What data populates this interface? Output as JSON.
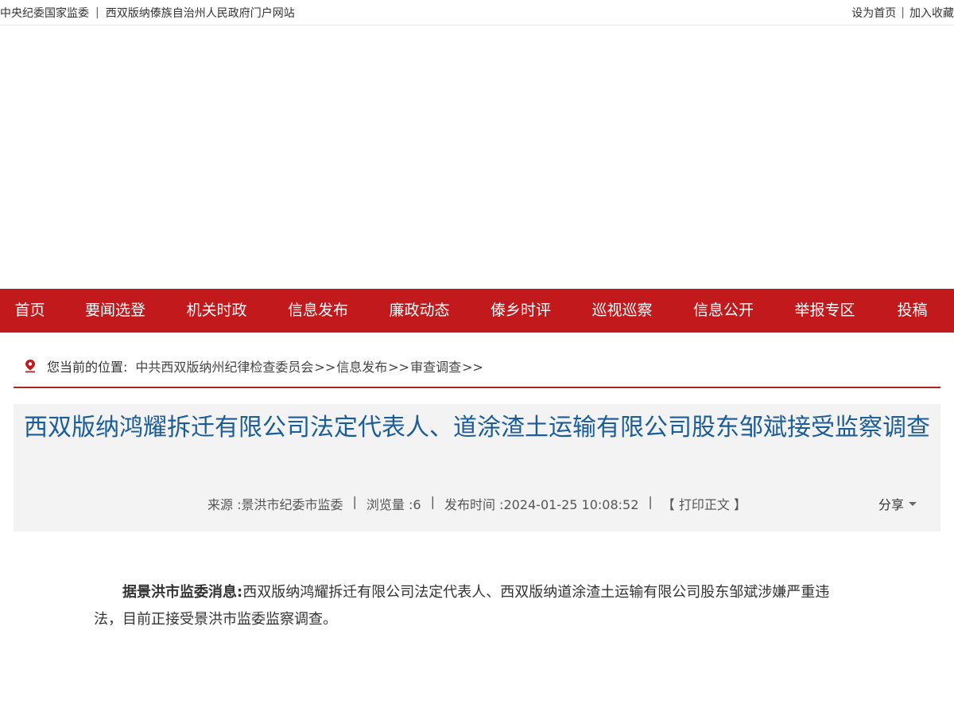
{
  "topbar": {
    "left_links": [
      "中央纪委国家监委",
      "西双版纳傣族自治州人民政府门户网站"
    ],
    "separator": "|",
    "right_links": [
      "设为首页",
      "加入收藏"
    ],
    "right_separator": "|"
  },
  "nav": {
    "items": [
      "首页",
      "要闻选登",
      "机关时政",
      "信息发布",
      "廉政动态",
      "傣乡时评",
      "巡视巡察",
      "信息公开",
      "举报专区",
      "投稿"
    ]
  },
  "breadcrumb": {
    "label": "您当前的位置:",
    "items": [
      "中共西双版纳州纪律检查委员会",
      "信息发布",
      "审查调查"
    ],
    "arrow": ">>"
  },
  "article": {
    "title": "西双版纳鸿耀拆迁有限公司法定代表人、道涂渣土运输有限公司股东邹斌接受监察调查",
    "source": "来源 :景洪市纪委市监委",
    "views": "浏览量 :6",
    "published": "发布时间 :2024-01-25 10:08:52",
    "print": "【 打印正文 】",
    "meta_separator": "|",
    "share": "分享",
    "lead": "据景洪市监委消息:",
    "body": "西双版纳鸿耀拆迁有限公司法定代表人、西双版纳道涂渣土运输有限公司股东邹斌涉嫌严重违法，目前正接受景洪市监委监察调查。"
  },
  "colors": {
    "nav_bg": "#c1191c",
    "title": "#1a5d9a",
    "breadcrumb_rule": "#b0231c"
  }
}
